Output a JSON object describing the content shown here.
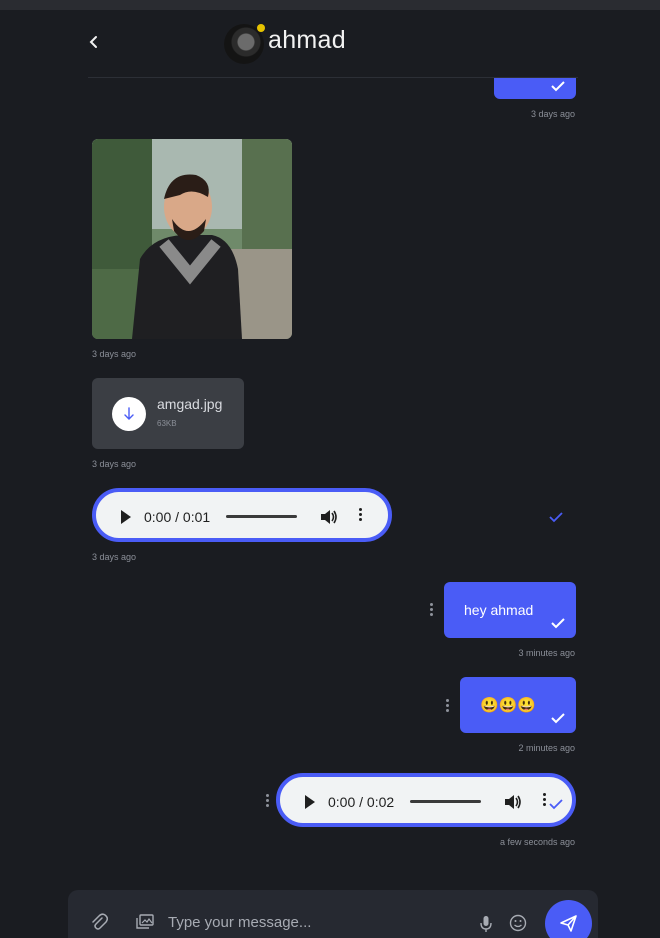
{
  "contact": {
    "name": "ahmad",
    "online": true,
    "status_color": "#e6c300"
  },
  "colors": {
    "accent": "#4a5cf6",
    "background": "#1a1c21",
    "received_bubble": "#3b3e44"
  },
  "messages": [
    {
      "type": "text-outgoing-partial",
      "time": "3 days ago",
      "status": "read"
    },
    {
      "type": "image-incoming",
      "time": "3 days ago"
    },
    {
      "type": "file-incoming",
      "file_name": "amgad.jpg",
      "file_size": "63KB",
      "time": "3 days ago",
      "icon": "download-icon"
    },
    {
      "type": "audio-incoming",
      "time_display": "0:00 / 0:01",
      "time": "3 days ago",
      "status": "read"
    },
    {
      "type": "text-outgoing",
      "text": "hey ahmad",
      "time": "3 minutes ago",
      "status": "read"
    },
    {
      "type": "text-outgoing",
      "text": "😃😃😃",
      "time": "2 minutes ago",
      "status": "read"
    },
    {
      "type": "audio-outgoing",
      "time_display": "0:00 / 0:02",
      "time": "a few seconds ago",
      "status": "read"
    }
  ],
  "composer": {
    "placeholder": "Type your message...",
    "icons": [
      "attach-icon",
      "image-icon",
      "microphone-icon",
      "emoji-icon",
      "send-icon"
    ]
  }
}
